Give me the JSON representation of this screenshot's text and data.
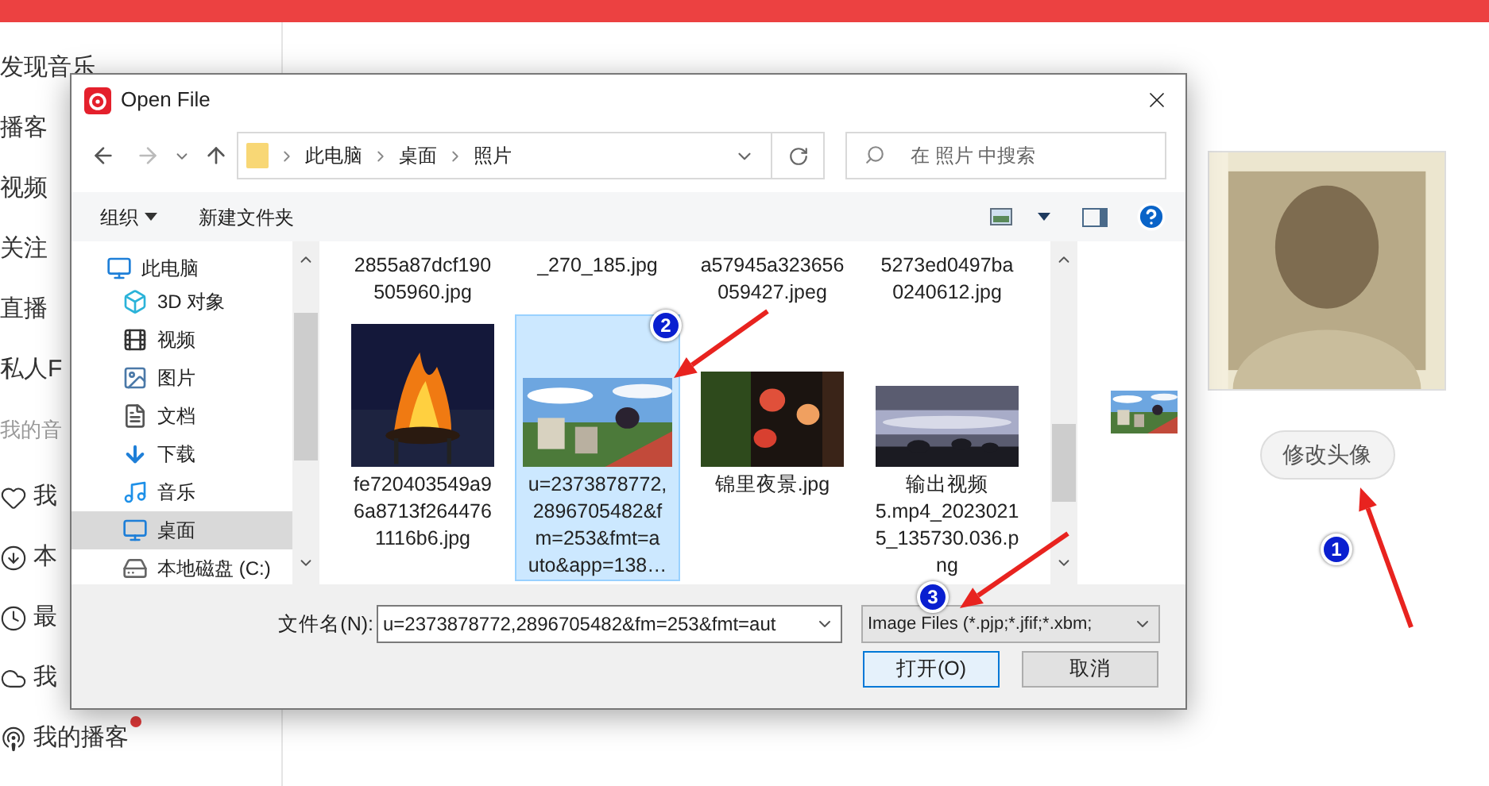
{
  "top_bar": {
    "kind": "accent"
  },
  "sidebar": {
    "items": [
      {
        "label": "发现音乐"
      },
      {
        "label": "播客"
      },
      {
        "label": "视频"
      },
      {
        "label": "关注"
      },
      {
        "label": "直播"
      },
      {
        "label": "私人F"
      }
    ],
    "section_title": "我的音",
    "my_items": [
      {
        "label": "我",
        "unread": false
      },
      {
        "label": "本",
        "unread": false
      },
      {
        "label": "最",
        "unread": false
      },
      {
        "label": "我",
        "unread": false
      },
      {
        "label": "我的播客",
        "unread": true
      }
    ]
  },
  "main": {
    "change_avatar_button": "修改头像"
  },
  "dialog": {
    "title": "Open File",
    "breadcrumb": [
      "此电脑",
      "桌面",
      "照片"
    ],
    "search": {
      "placeholder": "在 照片 中搜索"
    },
    "toolbar": {
      "organize": "组织",
      "new_folder": "新建文件夹"
    },
    "nav": [
      {
        "label": "此电脑",
        "selected": false,
        "children": [
          {
            "label": "3D 对象",
            "selected": false
          },
          {
            "label": "视频",
            "selected": false
          },
          {
            "label": "图片",
            "selected": false
          },
          {
            "label": "文档",
            "selected": false
          },
          {
            "label": "下载",
            "selected": false
          },
          {
            "label": "音乐",
            "selected": false
          },
          {
            "label": "桌面",
            "selected": true
          },
          {
            "label": "本地磁盘 (C:)",
            "selected": false
          }
        ]
      }
    ],
    "files_top": [
      {
        "name_lines": [
          "2855a87dcf190",
          "505960.jpg"
        ],
        "selected": false
      },
      {
        "name_lines": [
          "_270_185.jpg"
        ],
        "selected": false
      },
      {
        "name_lines": [
          "a57945a323656",
          "059427.jpeg"
        ],
        "selected": false
      },
      {
        "name_lines": [
          "5273ed0497ba",
          "0240612.jpg"
        ],
        "selected": false
      }
    ],
    "files": [
      {
        "name_lines": [
          "fe720403549a9",
          "6a8713f264476",
          "1116b6.jpg"
        ],
        "selected": false
      },
      {
        "name_lines": [
          "u=2373878772,",
          "2896705482&f",
          "m=253&fmt=a",
          "uto&app=138…"
        ],
        "selected": true
      },
      {
        "name_lines": [
          "锦里夜景.jpg"
        ],
        "selected": false
      },
      {
        "name_lines": [
          "输出视频",
          "5.mp4_2023021",
          "5_135730.036.p",
          "ng"
        ],
        "selected": false
      }
    ],
    "filename_label": "文件名(N):",
    "filename_value": "u=2373878772,2896705482&fm=253&fmt=aut",
    "filter": "Image Files (*.pjp;*.jfif;*.xbm;",
    "open_button": "打开(O)",
    "cancel_button": "取消"
  },
  "annotations": [
    {
      "label": "1"
    },
    {
      "label": "2"
    },
    {
      "label": "3"
    }
  ]
}
